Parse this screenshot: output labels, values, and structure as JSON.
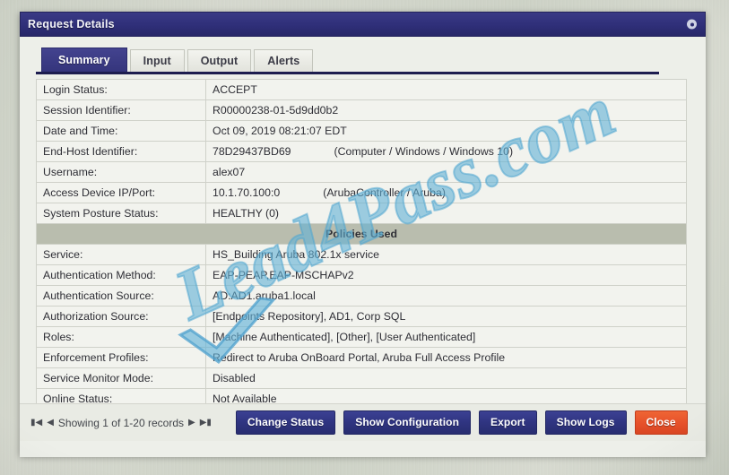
{
  "window": {
    "title": "Request Details",
    "close_icon": "close-dot-icon"
  },
  "tabs": [
    {
      "label": "Summary",
      "active": true
    },
    {
      "label": "Input",
      "active": false
    },
    {
      "label": "Output",
      "active": false
    },
    {
      "label": "Alerts",
      "active": false
    }
  ],
  "summary_rows": [
    {
      "label": "Login Status:",
      "value": "ACCEPT",
      "extra": ""
    },
    {
      "label": "Session Identifier:",
      "value": "R00000238-01-5d9dd0b2",
      "extra": ""
    },
    {
      "label": "Date and Time:",
      "value": "Oct 09, 2019 08:21:07 EDT",
      "extra": ""
    },
    {
      "label": "End-Host Identifier:",
      "value": "78D29437BD69",
      "extra": "(Computer / Windows / Windows 10)"
    },
    {
      "label": "Username:",
      "value": "alex07",
      "extra": ""
    },
    {
      "label": "Access Device IP/Port:",
      "value": "10.1.70.100:0",
      "extra": "(ArubaController / Aruba)"
    },
    {
      "label": "System Posture Status:",
      "value": "HEALTHY (0)",
      "extra": ""
    }
  ],
  "section_header": "Policies Used",
  "policy_rows": [
    {
      "label": "Service:",
      "value": "HS_Building Aruba 802.1x service",
      "extra": ""
    },
    {
      "label": "Authentication Method:",
      "value": "EAP-PEAP,EAP-MSCHAPv2",
      "extra": ""
    },
    {
      "label": "Authentication Source:",
      "value": "AD:AD1.aruba1.local",
      "extra": ""
    },
    {
      "label": "Authorization Source:",
      "value": "[Endpoints Repository], AD1, Corp SQL",
      "extra": ""
    },
    {
      "label": "Roles:",
      "value": "[Machine Authenticated], [Other], [User Authenticated]",
      "extra": ""
    },
    {
      "label": "Enforcement Profiles:",
      "value": "Redirect to Aruba OnBoard Portal, Aruba Full Access Profile",
      "extra": ""
    },
    {
      "label": "Service Monitor Mode:",
      "value": "Disabled",
      "extra": ""
    },
    {
      "label": "Online Status:",
      "value": "Not Available",
      "extra": ""
    }
  ],
  "footer": {
    "first_icon": "▮◀",
    "prev_icon": "◀",
    "records_text": "Showing 1 of 1-20 records",
    "next_icon": "▶",
    "last_icon": "▶▮",
    "buttons": [
      {
        "label": "Change Status",
        "style": "primary"
      },
      {
        "label": "Show Configuration",
        "style": "primary"
      },
      {
        "label": "Export",
        "style": "primary"
      },
      {
        "label": "Show Logs",
        "style": "primary"
      },
      {
        "label": "Close",
        "style": "danger"
      }
    ]
  },
  "watermark": {
    "text": "Lead4Pass.com"
  },
  "colors": {
    "titlebar": "#2f2f79",
    "tab_active": "#3a3a85",
    "section_bar": "#b9bdae",
    "button_primary": "#2f3480",
    "button_danger": "#e6512a",
    "watermark": "#60b0d6"
  }
}
